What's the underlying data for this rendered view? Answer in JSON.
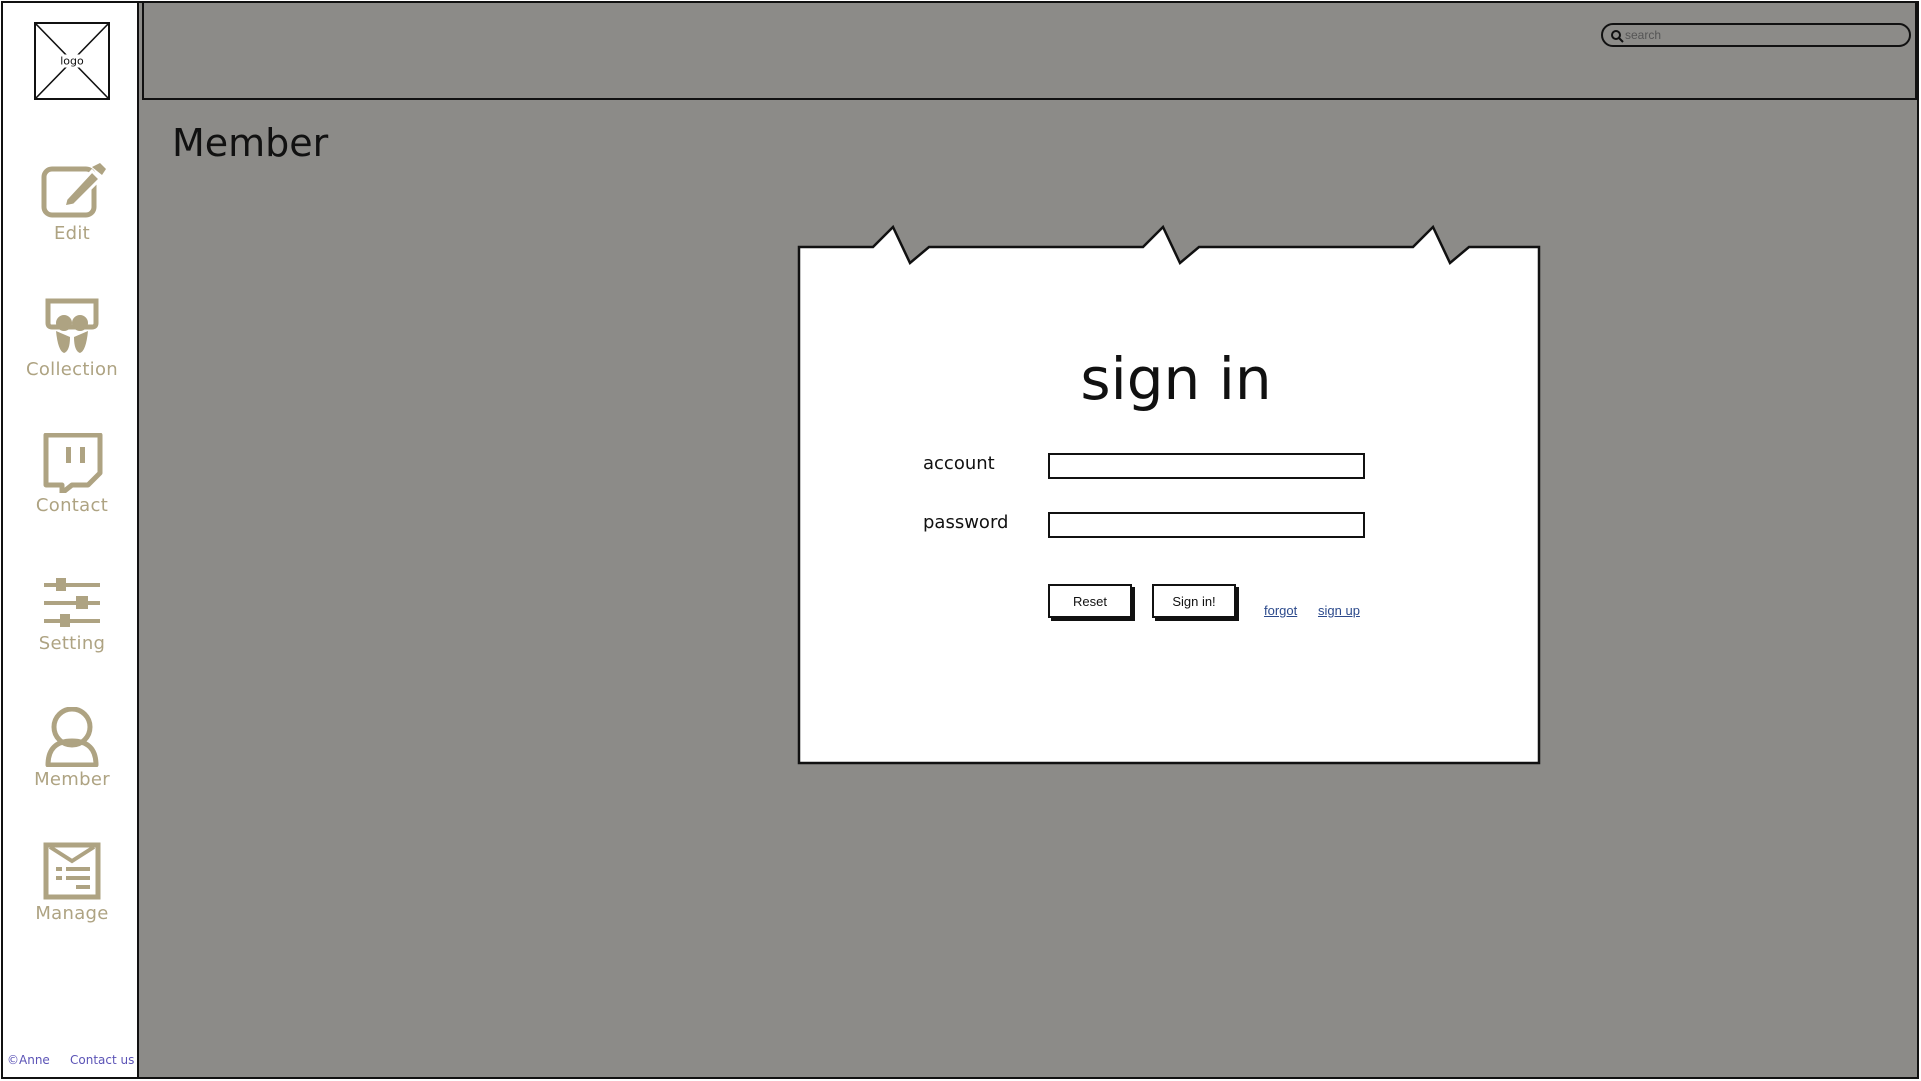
{
  "sidebar": {
    "logo_label": "logo",
    "items": [
      {
        "label": "Edit",
        "icon": "edit-icon"
      },
      {
        "label": "Collection",
        "icon": "collection-icon"
      },
      {
        "label": "Contact",
        "icon": "contact-icon"
      },
      {
        "label": "Setting",
        "icon": "setting-icon"
      },
      {
        "label": "Member",
        "icon": "member-icon"
      },
      {
        "label": "Manage",
        "icon": "manage-icon"
      }
    ],
    "footer": {
      "copyright": "©Anne",
      "contact_link": "Contact us"
    }
  },
  "header": {
    "search_placeholder": "search"
  },
  "main": {
    "page_title": "Member"
  },
  "signin": {
    "title": "sign in",
    "account_label": "account",
    "password_label": "password",
    "account_value": "",
    "password_value": "",
    "reset_label": "Reset",
    "submit_label": "Sign in!",
    "forgot_label": "forgot",
    "signup_label": "sign up"
  },
  "colors": {
    "main_bg": "#8c8b88",
    "icon_color": "#aea382",
    "link_color": "#2c4a8c",
    "footer_color": "#5b53b6"
  }
}
